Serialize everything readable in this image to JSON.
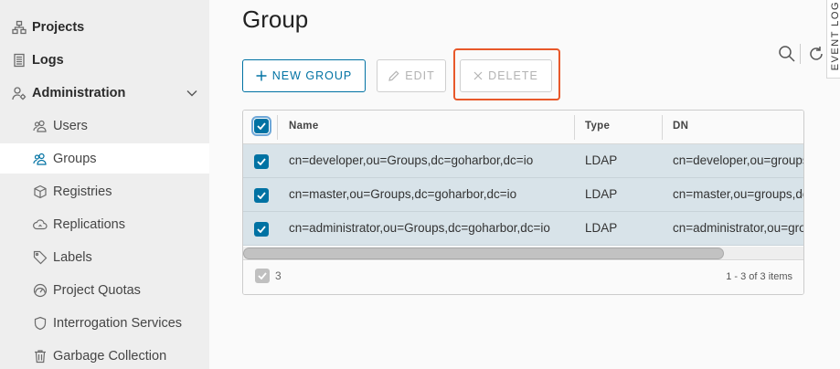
{
  "sidebar": {
    "items": [
      {
        "label": "Projects",
        "icon": "projects-icon"
      },
      {
        "label": "Logs",
        "icon": "logs-icon"
      },
      {
        "label": "Administration",
        "icon": "administration-icon"
      },
      {
        "label": "Users",
        "icon": "users-icon"
      },
      {
        "label": "Groups",
        "icon": "groups-icon",
        "active": true
      },
      {
        "label": "Registries",
        "icon": "registries-icon"
      },
      {
        "label": "Replications",
        "icon": "replications-icon"
      },
      {
        "label": "Labels",
        "icon": "labels-icon"
      },
      {
        "label": "Project Quotas",
        "icon": "project-quotas-icon"
      },
      {
        "label": "Interrogation Services",
        "icon": "interrogation-services-icon"
      },
      {
        "label": "Garbage Collection",
        "icon": "garbage-collection-icon"
      }
    ]
  },
  "page": {
    "title": "Group",
    "event_tab": "EVENT LOG"
  },
  "toolbar": {
    "new_label": "NEW GROUP",
    "edit_label": "EDIT",
    "delete_label": "DELETE"
  },
  "table": {
    "columns": [
      "Name",
      "Type",
      "DN"
    ],
    "rows": [
      {
        "name": "cn=developer,ou=Groups,dc=goharbor,dc=io",
        "type": "LDAP",
        "dn": "cn=developer,ou=groups,dc=goharbor,dc=io"
      },
      {
        "name": "cn=master,ou=Groups,dc=goharbor,dc=io",
        "type": "LDAP",
        "dn": "cn=master,ou=groups,dc=goharbor,dc=io"
      },
      {
        "name": "cn=administrator,ou=Groups,dc=goharbor,dc=io",
        "type": "LDAP",
        "dn": "cn=administrator,ou=groups,dc=goharbor,dc=io"
      }
    ],
    "selected_count": "3",
    "pagination": "1 - 3 of 3 items"
  },
  "colors": {
    "accent": "#0072a3",
    "selected_row": "#d8e3e9",
    "highlight": "#e8582a"
  }
}
